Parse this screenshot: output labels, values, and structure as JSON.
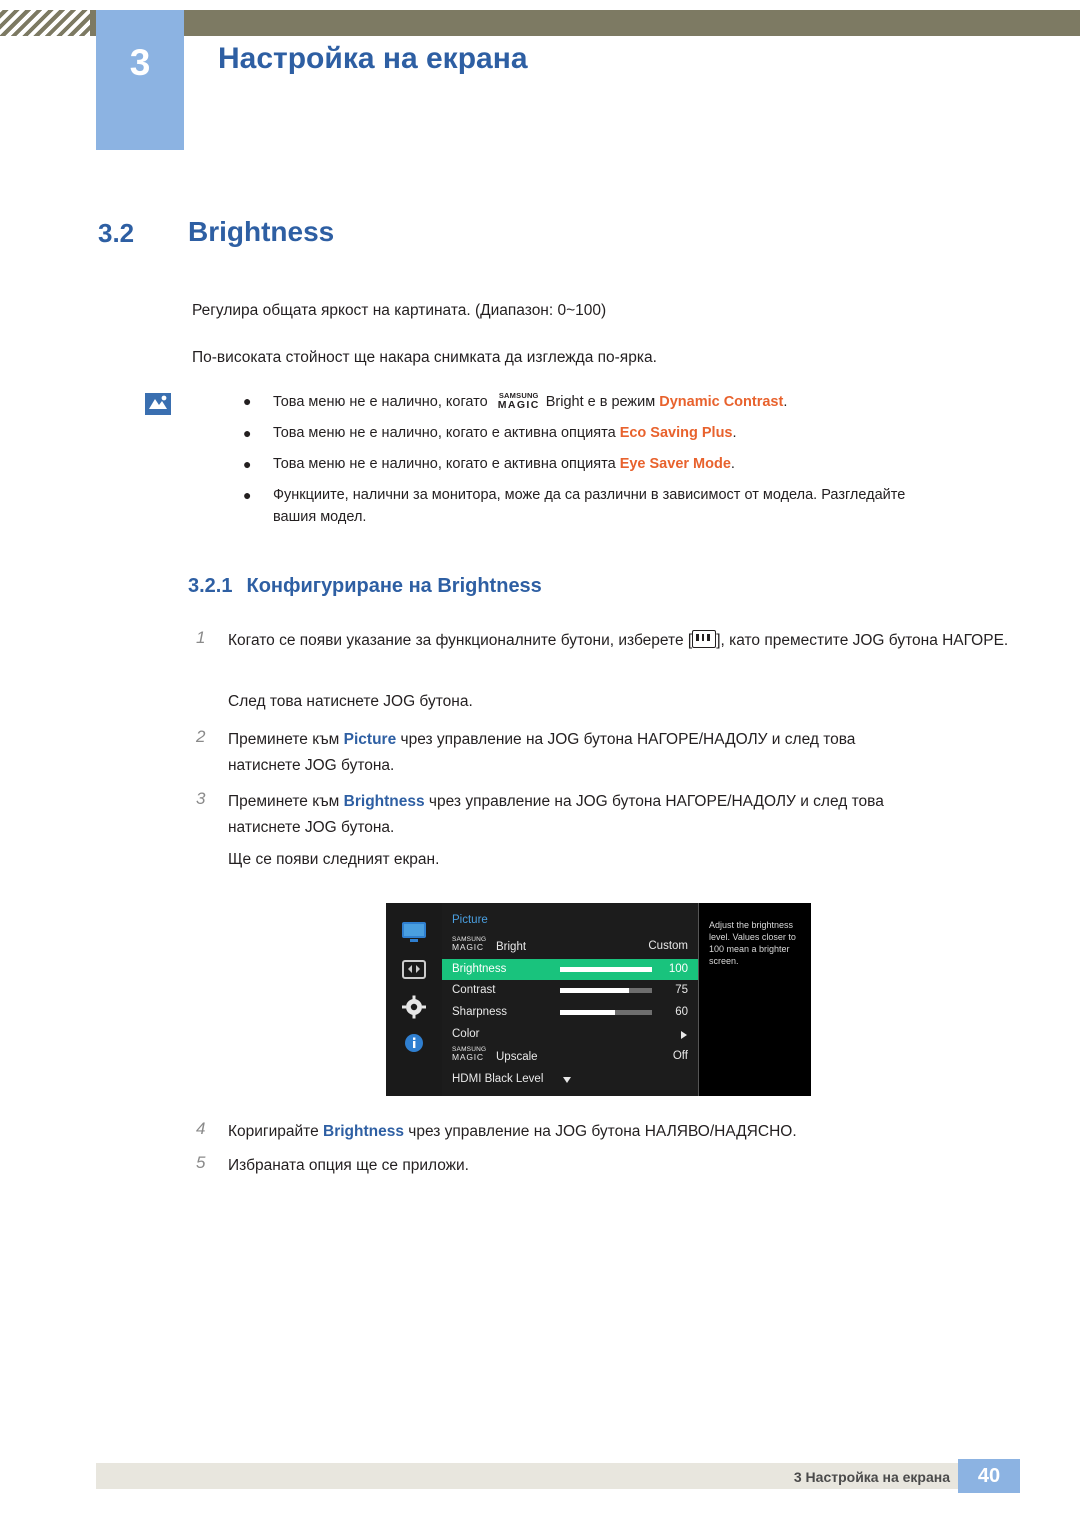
{
  "header": {
    "chapter_number": "3",
    "chapter_title": "Настройка на екрана"
  },
  "section": {
    "number": "3.2",
    "title": "Brightness"
  },
  "body": {
    "para1": "Регулира общата яркост на картината. (Диапазон: 0~100)",
    "para2": "По-високата стойност ще накара снимката да изглежда по-ярка."
  },
  "notes": [
    {
      "prefix": "Това меню не е налично, когато ",
      "magic_top": "SAMSUNG",
      "magic_bottom": "MAGIC",
      "mid": "Bright е в режим ",
      "highlight": "Dynamic Contrast",
      "suffix": "."
    },
    {
      "prefix": "Това меню не е налично, когато е активна опцията ",
      "highlight": "Eco Saving Plus",
      "suffix": "."
    },
    {
      "prefix": "Това меню не е налично, когато е активна опцията ",
      "highlight": "Eye Saver Mode",
      "suffix": "."
    },
    {
      "prefix": "Функциите, налични за монитора, може да са различни в зависимост от модела. Разгледайте вашия модел.",
      "highlight": "",
      "suffix": ""
    }
  ],
  "subsection": {
    "number": "3.2.1",
    "title": "Конфигуриране на Brightness"
  },
  "steps": [
    {
      "num": "1",
      "pre": "Когато се появи указание за функционалните бутони, изберете [",
      "post": "], като преместите JOG бутона НАГОРЕ.",
      "line2": "След това натиснете JOG бутона."
    },
    {
      "num": "2",
      "pre": "Преминете към ",
      "bold": "Picture",
      "post": " чрез управление на JOG бутона НАГОРЕ/НАДОЛУ и след това",
      "line2": "натиснете JOG бутона."
    },
    {
      "num": "3",
      "pre": "Преминете към ",
      "bold": "Brightness",
      "post": " чрез управление на JOG бутона НАГОРЕ/НАДОЛУ и след това",
      "line2": "натиснете JOG бутона.",
      "line3": "Ще се появи следният екран."
    },
    {
      "num": "4",
      "pre": "Коригирайте ",
      "bold": "Brightness",
      "post": " чрез управление на JOG бутона НАЛЯВО/НАДЯСНО."
    },
    {
      "num": "5",
      "pre": "Избраната опция ще се приложи.",
      "bold": "",
      "post": ""
    }
  ],
  "osd": {
    "title": "Picture",
    "rows": [
      {
        "label": "Bright",
        "magic_top": "SAMSUNG",
        "magic_bottom": "MAGIC",
        "value": "Custom",
        "type": "magic"
      },
      {
        "label": "Brightness",
        "value": "100",
        "type": "slider",
        "fill_pct": 100,
        "selected": true
      },
      {
        "label": "Contrast",
        "value": "75",
        "type": "slider",
        "fill_pct": 75,
        "selected": false
      },
      {
        "label": "Sharpness",
        "value": "60",
        "type": "slider",
        "fill_pct": 60,
        "selected": false
      },
      {
        "label": "Color",
        "value": "",
        "type": "arrow",
        "selected": false
      },
      {
        "label": "Upscale",
        "magic_top": "SAMSUNG",
        "magic_bottom": "MAGIC",
        "value": "Off",
        "type": "magic"
      },
      {
        "label": "HDMI Black Level",
        "value": "",
        "type": "more",
        "selected": false
      }
    ],
    "help_text": "Adjust the brightness level. Values closer to 100 mean a brighter screen."
  },
  "footer": {
    "text": "3 Настройка на екрана",
    "page": "40"
  }
}
